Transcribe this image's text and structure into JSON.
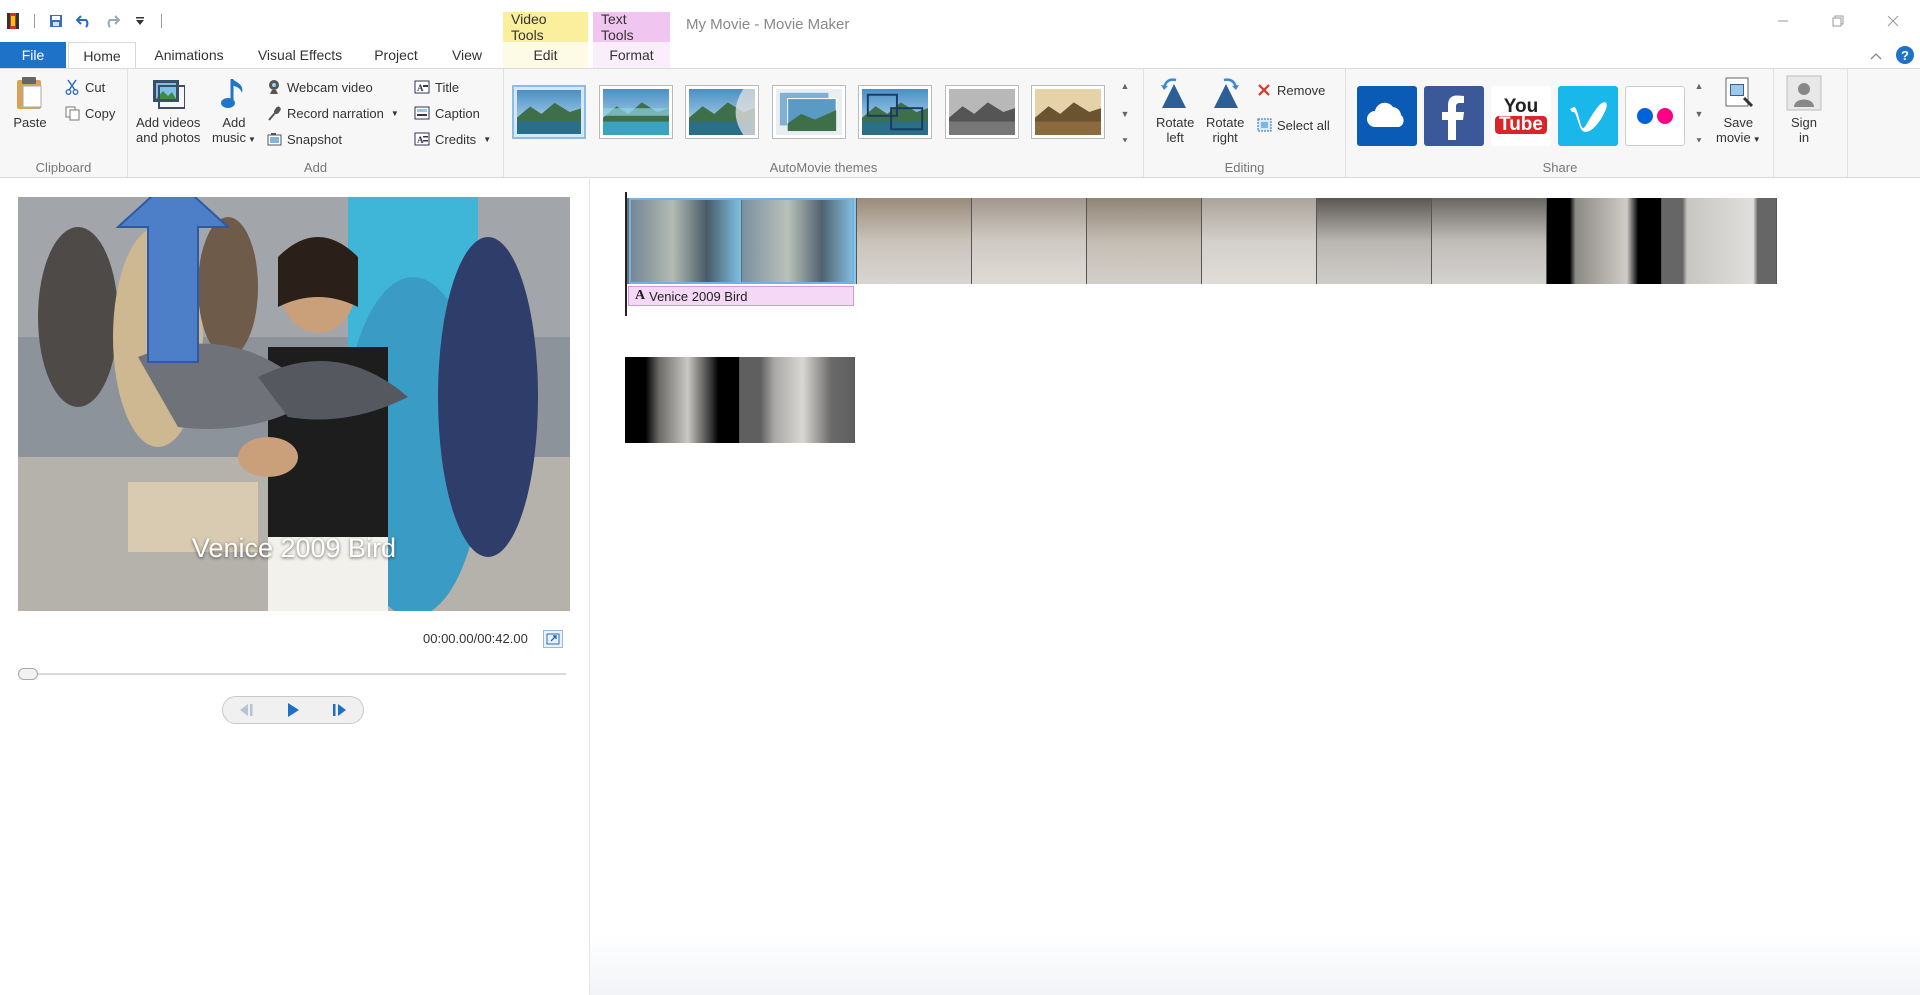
{
  "window": {
    "title": "My Movie - Movie Maker",
    "context_tabs": {
      "video_tools": "Video Tools",
      "text_tools": "Text Tools"
    }
  },
  "tabs": {
    "file": "File",
    "home": "Home",
    "animations": "Animations",
    "visual_effects": "Visual Effects",
    "project": "Project",
    "view": "View",
    "edit": "Edit",
    "format": "Format"
  },
  "ribbon": {
    "clipboard": {
      "label": "Clipboard",
      "paste": "Paste",
      "cut": "Cut",
      "copy": "Copy"
    },
    "add": {
      "label": "Add",
      "add_videos_line1": "Add videos",
      "add_videos_line2": "and photos",
      "add_music_line1": "Add",
      "add_music_line2": "music",
      "webcam_video": "Webcam video",
      "record_narration": "Record narration",
      "snapshot": "Snapshot",
      "title": "Title",
      "caption": "Caption",
      "credits": "Credits"
    },
    "themes": {
      "label": "AutoMovie themes",
      "count": 7,
      "selected_index": 0
    },
    "editing": {
      "label": "Editing",
      "rotate_left_line1": "Rotate",
      "rotate_left_line2": "left",
      "rotate_right_line1": "Rotate",
      "rotate_right_line2": "right",
      "remove": "Remove",
      "select_all": "Select all"
    },
    "share": {
      "label": "Share",
      "services": [
        "onedrive",
        "facebook",
        "youtube",
        "vimeo",
        "flickr"
      ],
      "youtube_line1": "You",
      "youtube_line2": "Tube",
      "save_movie_line1": "Save",
      "save_movie_line2": "movie",
      "sign_in_line1": "Sign",
      "sign_in_line2": "in"
    }
  },
  "preview": {
    "caption_text": "Venice 2009 Bird",
    "timecode": "00:00.00/00:42.00",
    "position_fraction": 0.0
  },
  "storyboard": {
    "text_track_label": "Venice 2009 Bird",
    "track1_thumb_count": 10,
    "track2_thumb_count": 2
  },
  "colors": {
    "file_tab": "#1e72c8",
    "video_tools": "#f9ef9c",
    "text_tools": "#f0c6f0",
    "arrow": "#4a7bc4",
    "text_track": "#f4d8f6"
  }
}
